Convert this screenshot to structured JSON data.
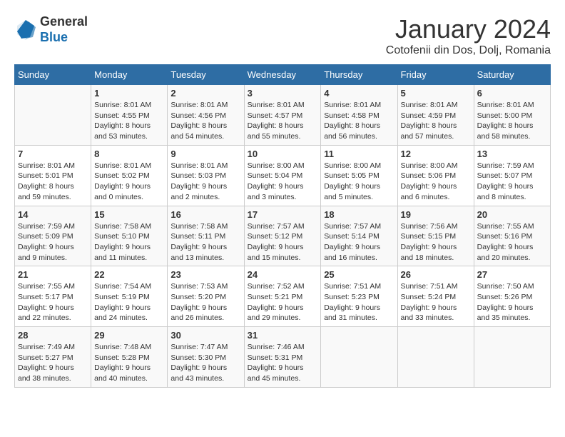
{
  "header": {
    "logo_general": "General",
    "logo_blue": "Blue",
    "title": "January 2024",
    "subtitle": "Cotofenii din Dos, Dolj, Romania"
  },
  "days_of_week": [
    "Sunday",
    "Monday",
    "Tuesday",
    "Wednesday",
    "Thursday",
    "Friday",
    "Saturday"
  ],
  "weeks": [
    [
      {
        "day": "",
        "info": ""
      },
      {
        "day": "1",
        "info": "Sunrise: 8:01 AM\nSunset: 4:55 PM\nDaylight: 8 hours\nand 53 minutes."
      },
      {
        "day": "2",
        "info": "Sunrise: 8:01 AM\nSunset: 4:56 PM\nDaylight: 8 hours\nand 54 minutes."
      },
      {
        "day": "3",
        "info": "Sunrise: 8:01 AM\nSunset: 4:57 PM\nDaylight: 8 hours\nand 55 minutes."
      },
      {
        "day": "4",
        "info": "Sunrise: 8:01 AM\nSunset: 4:58 PM\nDaylight: 8 hours\nand 56 minutes."
      },
      {
        "day": "5",
        "info": "Sunrise: 8:01 AM\nSunset: 4:59 PM\nDaylight: 8 hours\nand 57 minutes."
      },
      {
        "day": "6",
        "info": "Sunrise: 8:01 AM\nSunset: 5:00 PM\nDaylight: 8 hours\nand 58 minutes."
      }
    ],
    [
      {
        "day": "7",
        "info": "Sunrise: 8:01 AM\nSunset: 5:01 PM\nDaylight: 8 hours\nand 59 minutes."
      },
      {
        "day": "8",
        "info": "Sunrise: 8:01 AM\nSunset: 5:02 PM\nDaylight: 9 hours\nand 0 minutes."
      },
      {
        "day": "9",
        "info": "Sunrise: 8:01 AM\nSunset: 5:03 PM\nDaylight: 9 hours\nand 2 minutes."
      },
      {
        "day": "10",
        "info": "Sunrise: 8:00 AM\nSunset: 5:04 PM\nDaylight: 9 hours\nand 3 minutes."
      },
      {
        "day": "11",
        "info": "Sunrise: 8:00 AM\nSunset: 5:05 PM\nDaylight: 9 hours\nand 5 minutes."
      },
      {
        "day": "12",
        "info": "Sunrise: 8:00 AM\nSunset: 5:06 PM\nDaylight: 9 hours\nand 6 minutes."
      },
      {
        "day": "13",
        "info": "Sunrise: 7:59 AM\nSunset: 5:07 PM\nDaylight: 9 hours\nand 8 minutes."
      }
    ],
    [
      {
        "day": "14",
        "info": "Sunrise: 7:59 AM\nSunset: 5:09 PM\nDaylight: 9 hours\nand 9 minutes."
      },
      {
        "day": "15",
        "info": "Sunrise: 7:58 AM\nSunset: 5:10 PM\nDaylight: 9 hours\nand 11 minutes."
      },
      {
        "day": "16",
        "info": "Sunrise: 7:58 AM\nSunset: 5:11 PM\nDaylight: 9 hours\nand 13 minutes."
      },
      {
        "day": "17",
        "info": "Sunrise: 7:57 AM\nSunset: 5:12 PM\nDaylight: 9 hours\nand 15 minutes."
      },
      {
        "day": "18",
        "info": "Sunrise: 7:57 AM\nSunset: 5:14 PM\nDaylight: 9 hours\nand 16 minutes."
      },
      {
        "day": "19",
        "info": "Sunrise: 7:56 AM\nSunset: 5:15 PM\nDaylight: 9 hours\nand 18 minutes."
      },
      {
        "day": "20",
        "info": "Sunrise: 7:55 AM\nSunset: 5:16 PM\nDaylight: 9 hours\nand 20 minutes."
      }
    ],
    [
      {
        "day": "21",
        "info": "Sunrise: 7:55 AM\nSunset: 5:17 PM\nDaylight: 9 hours\nand 22 minutes."
      },
      {
        "day": "22",
        "info": "Sunrise: 7:54 AM\nSunset: 5:19 PM\nDaylight: 9 hours\nand 24 minutes."
      },
      {
        "day": "23",
        "info": "Sunrise: 7:53 AM\nSunset: 5:20 PM\nDaylight: 9 hours\nand 26 minutes."
      },
      {
        "day": "24",
        "info": "Sunrise: 7:52 AM\nSunset: 5:21 PM\nDaylight: 9 hours\nand 29 minutes."
      },
      {
        "day": "25",
        "info": "Sunrise: 7:51 AM\nSunset: 5:23 PM\nDaylight: 9 hours\nand 31 minutes."
      },
      {
        "day": "26",
        "info": "Sunrise: 7:51 AM\nSunset: 5:24 PM\nDaylight: 9 hours\nand 33 minutes."
      },
      {
        "day": "27",
        "info": "Sunrise: 7:50 AM\nSunset: 5:26 PM\nDaylight: 9 hours\nand 35 minutes."
      }
    ],
    [
      {
        "day": "28",
        "info": "Sunrise: 7:49 AM\nSunset: 5:27 PM\nDaylight: 9 hours\nand 38 minutes."
      },
      {
        "day": "29",
        "info": "Sunrise: 7:48 AM\nSunset: 5:28 PM\nDaylight: 9 hours\nand 40 minutes."
      },
      {
        "day": "30",
        "info": "Sunrise: 7:47 AM\nSunset: 5:30 PM\nDaylight: 9 hours\nand 43 minutes."
      },
      {
        "day": "31",
        "info": "Sunrise: 7:46 AM\nSunset: 5:31 PM\nDaylight: 9 hours\nand 45 minutes."
      },
      {
        "day": "",
        "info": ""
      },
      {
        "day": "",
        "info": ""
      },
      {
        "day": "",
        "info": ""
      }
    ]
  ]
}
